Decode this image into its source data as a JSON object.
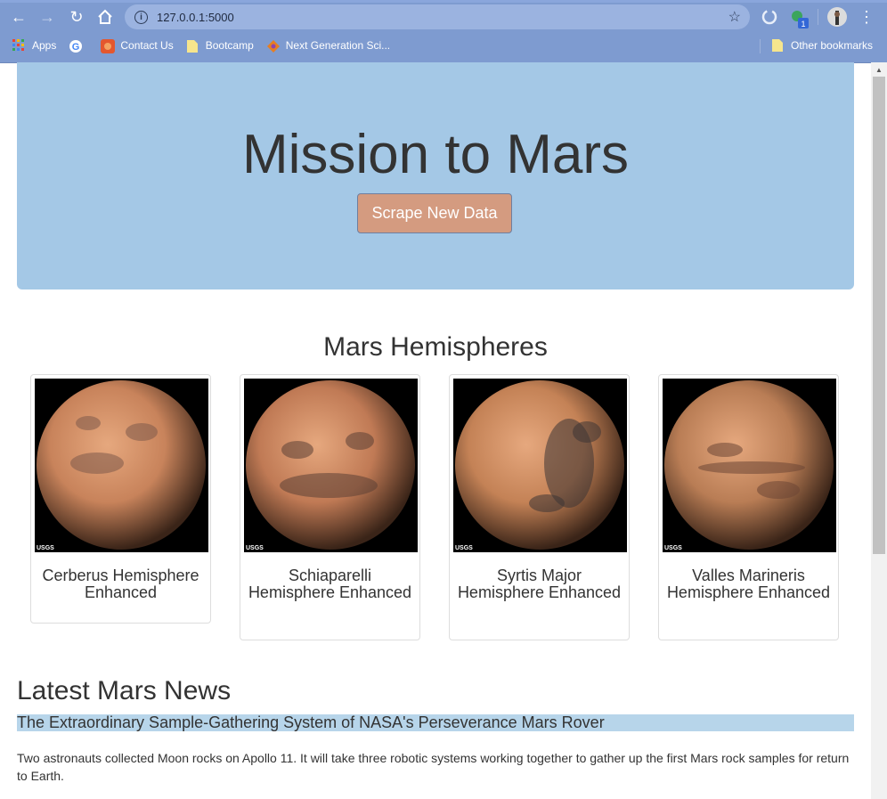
{
  "browser": {
    "url": "127.0.0.1:5000",
    "bookmarks": [
      {
        "label": "Apps",
        "icon": "apps-grid-icon"
      },
      {
        "label": "",
        "icon": "google-icon"
      },
      {
        "label": "Contact Us",
        "icon": "contact-us-icon"
      },
      {
        "label": "Bootcamp",
        "icon": "folder-icon"
      },
      {
        "label": "Next Generation Sci...",
        "icon": "ngss-icon"
      }
    ],
    "other_bookmarks": "Other bookmarks",
    "extension_badge": "1"
  },
  "jumbotron": {
    "title": "Mission to Mars",
    "button_label": "Scrape New Data"
  },
  "hemispheres": {
    "title": "Mars Hemispheres",
    "items": [
      {
        "title": "Cerberus Hemisphere Enhanced",
        "color": "#c8835b",
        "dark": "#7d5a4a"
      },
      {
        "title": "Schiaparelli Hemisphere Enhanced",
        "color": "#c07a55",
        "dark": "#5b3f35"
      },
      {
        "title": "Syrtis Major Hemisphere Enhanced",
        "color": "#c48256",
        "dark": "#3d3535"
      },
      {
        "title": "Valles Marineris Hemisphere Enhanced",
        "color": "#b97d55",
        "dark": "#6b4535"
      }
    ],
    "image_label": "USGS"
  },
  "news": {
    "section_title": "Latest Mars News",
    "headline": "The Extraordinary Sample-Gathering System of NASA's Perseverance Mars Rover",
    "paragraph": "Two astronauts collected Moon rocks on Apollo 11. It will take three robotic systems working together to gather up the first Mars rock samples for return to Earth."
  }
}
